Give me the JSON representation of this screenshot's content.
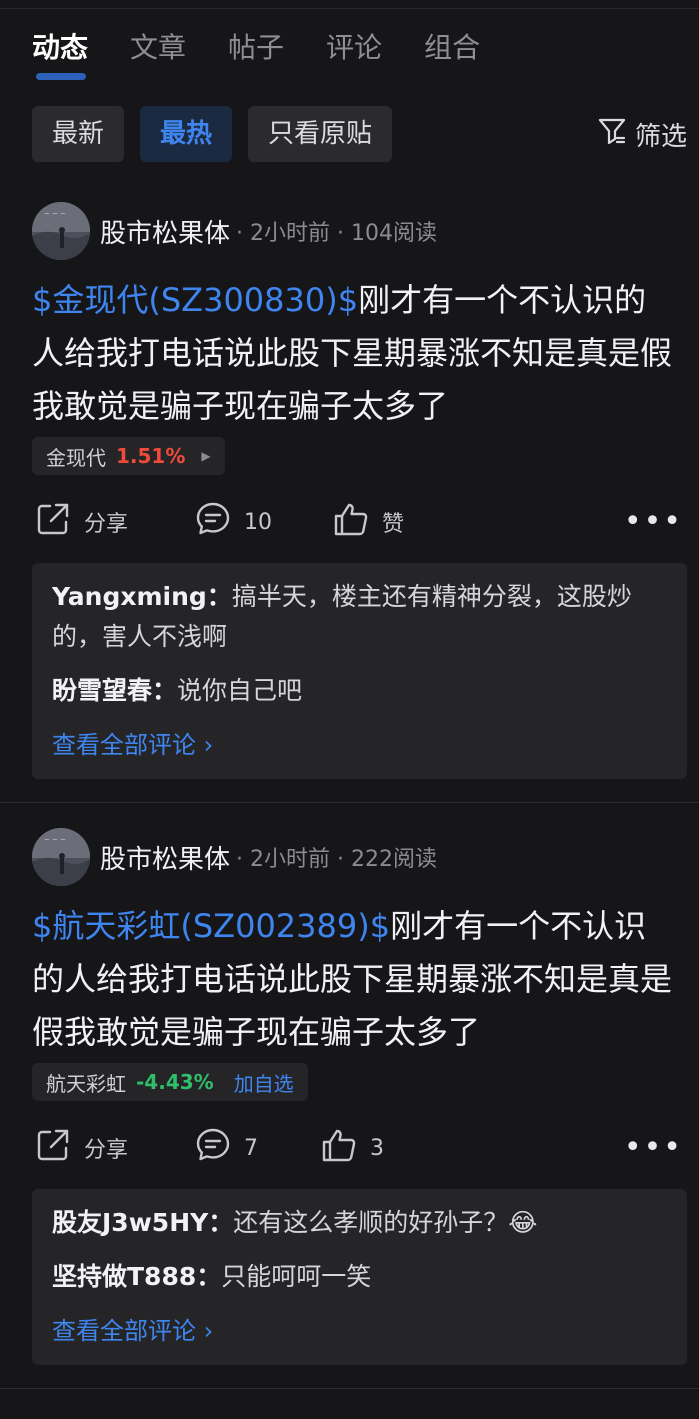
{
  "tabs": [
    {
      "label": "动态",
      "active": true
    },
    {
      "label": "文章"
    },
    {
      "label": "帖子"
    },
    {
      "label": "评论"
    },
    {
      "label": "组合"
    }
  ],
  "filters": {
    "chips": [
      "最新",
      "最热",
      "只看原贴"
    ],
    "active": "最热",
    "filter_label": "筛选"
  },
  "posts": [
    {
      "author": "股市松果体",
      "time": "2小时前",
      "reads": "104阅读",
      "stock_link": "$金现代(SZ300830)$",
      "text": "刚才有一个不认识的人给我打电话说此股下星期暴涨不知是真是假我敢觉是骗子现在骗子太多了",
      "stock_name": "金现代",
      "stock_change": "1.51%",
      "share_label": "分享",
      "comment_count": "10",
      "like_label": "赞",
      "comments": [
        {
          "user": "Yangxming：",
          "text": "搞半天，楼主还有精神分裂，这股炒的，害人不浅啊"
        },
        {
          "user": "盼雪望春：",
          "text": "说你自己吧"
        }
      ],
      "view_all": "查看全部评论 ›"
    },
    {
      "author": "股市松果体",
      "time": "2小时前",
      "reads": "222阅读",
      "stock_link": "$航天彩虹(SZ002389)$",
      "text": "刚才有一个不认识的人给我打电话说此股下星期暴涨不知是真是假我敢觉是骗子现在骗子太多了",
      "stock_name": "航天彩虹",
      "stock_change": "-4.43%",
      "add_watch": "加自选",
      "share_label": "分享",
      "comment_count": "7",
      "like_count": "3",
      "comments": [
        {
          "user": "股友J3w5HY：",
          "text": "还有这么孝顺的好孙子？😂"
        },
        {
          "user": "坚持做T888：",
          "text": "只能呵呵一笑"
        }
      ],
      "view_all": "查看全部评论 ›"
    }
  ],
  "meta_separator": " · ",
  "colors": {
    "accent": "#3f85f0",
    "up": "#f04a3a",
    "down": "#2fbf6a"
  }
}
